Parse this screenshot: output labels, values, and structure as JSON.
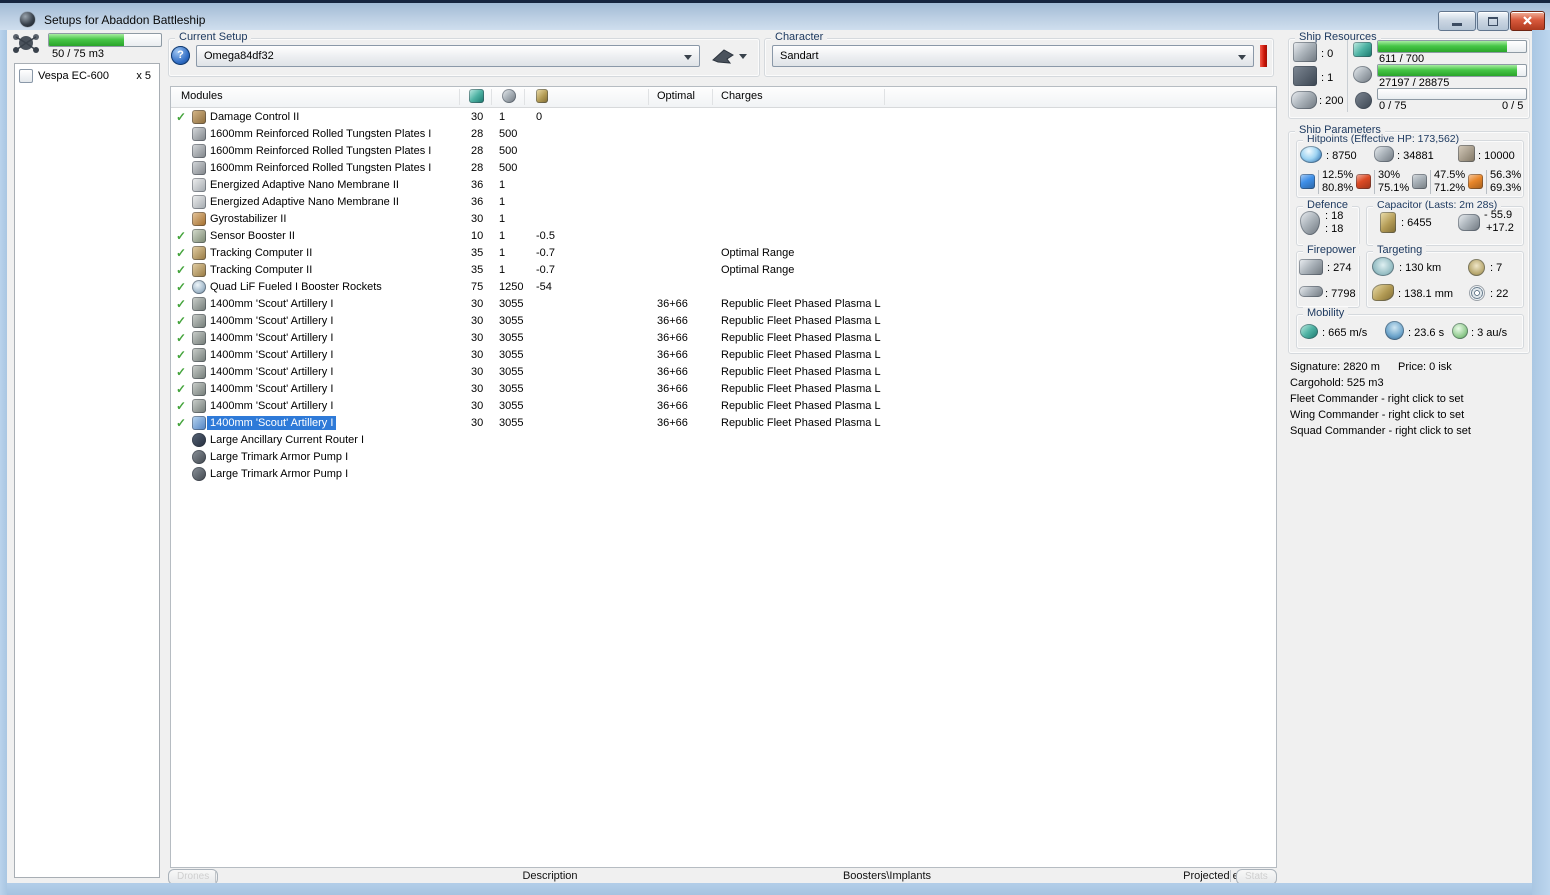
{
  "glyphs": {
    "check": "✓",
    "help": "?"
  },
  "window": {
    "title": "Setups for Abaddon Battleship"
  },
  "drone_bay": {
    "usage": "50 / 75 m3",
    "fill_pct": 67,
    "items": [
      {
        "name": "Vespa EC-600",
        "count": "x 5"
      }
    ]
  },
  "current_setup": {
    "label": "Current Setup",
    "value": "Omega84df32"
  },
  "character": {
    "label": "Character",
    "value": "Sandart"
  },
  "modules": {
    "columns": {
      "name": "Modules",
      "optimal": "Optimal",
      "charges": "Charges"
    },
    "rows": [
      {
        "name": "Damage Control II",
        "cpu": "30",
        "pg": "1",
        "cap": "0",
        "optimal": "",
        "charges": "",
        "checked": true,
        "icon": "i-dc"
      },
      {
        "name": "1600mm Reinforced Rolled Tungsten Plates I",
        "cpu": "28",
        "pg": "500",
        "cap": "",
        "optimal": "",
        "charges": "",
        "icon": "i-plate"
      },
      {
        "name": "1600mm Reinforced Rolled Tungsten Plates I",
        "cpu": "28",
        "pg": "500",
        "cap": "",
        "optimal": "",
        "charges": "",
        "icon": "i-plate"
      },
      {
        "name": "1600mm Reinforced Rolled Tungsten Plates I",
        "cpu": "28",
        "pg": "500",
        "cap": "",
        "optimal": "",
        "charges": "",
        "icon": "i-plate"
      },
      {
        "name": "Energized Adaptive Nano Membrane II",
        "cpu": "36",
        "pg": "1",
        "cap": "",
        "optimal": "",
        "charges": "",
        "icon": "i-eanm"
      },
      {
        "name": "Energized Adaptive Nano Membrane II",
        "cpu": "36",
        "pg": "1",
        "cap": "",
        "optimal": "",
        "charges": "",
        "icon": "i-eanm"
      },
      {
        "name": "Gyrostabilizer II",
        "cpu": "30",
        "pg": "1",
        "cap": "",
        "optimal": "",
        "charges": "",
        "icon": "i-gyro"
      },
      {
        "name": "Sensor Booster II",
        "cpu": "10",
        "pg": "1",
        "cap": "-0.5",
        "optimal": "",
        "charges": "",
        "checked": true,
        "icon": "i-senso"
      },
      {
        "name": "Tracking Computer II",
        "cpu": "35",
        "pg": "1",
        "cap": "-0.7",
        "optimal": "",
        "charges": "Optimal Range",
        "checked": true,
        "icon": "i-tc"
      },
      {
        "name": "Tracking Computer II",
        "cpu": "35",
        "pg": "1",
        "cap": "-0.7",
        "optimal": "",
        "charges": "Optimal Range",
        "checked": true,
        "icon": "i-tc"
      },
      {
        "name": "Quad LiF Fueled I Booster Rockets",
        "cpu": "75",
        "pg": "1250",
        "cap": "-54",
        "optimal": "",
        "charges": "",
        "checked": true,
        "icon": "i-mwd"
      },
      {
        "name": "1400mm 'Scout' Artillery I",
        "cpu": "30",
        "pg": "3055",
        "cap": "",
        "optimal": "36+66",
        "charges": "Republic Fleet Phased Plasma L",
        "checked": true,
        "icon": "i-arty"
      },
      {
        "name": "1400mm 'Scout' Artillery I",
        "cpu": "30",
        "pg": "3055",
        "cap": "",
        "optimal": "36+66",
        "charges": "Republic Fleet Phased Plasma L",
        "checked": true,
        "icon": "i-arty"
      },
      {
        "name": "1400mm 'Scout' Artillery I",
        "cpu": "30",
        "pg": "3055",
        "cap": "",
        "optimal": "36+66",
        "charges": "Republic Fleet Phased Plasma L",
        "checked": true,
        "icon": "i-arty"
      },
      {
        "name": "1400mm 'Scout' Artillery I",
        "cpu": "30",
        "pg": "3055",
        "cap": "",
        "optimal": "36+66",
        "charges": "Republic Fleet Phased Plasma L",
        "checked": true,
        "icon": "i-arty"
      },
      {
        "name": "1400mm 'Scout' Artillery I",
        "cpu": "30",
        "pg": "3055",
        "cap": "",
        "optimal": "36+66",
        "charges": "Republic Fleet Phased Plasma L",
        "checked": true,
        "icon": "i-arty"
      },
      {
        "name": "1400mm 'Scout' Artillery I",
        "cpu": "30",
        "pg": "3055",
        "cap": "",
        "optimal": "36+66",
        "charges": "Republic Fleet Phased Plasma L",
        "checked": true,
        "icon": "i-arty"
      },
      {
        "name": "1400mm 'Scout' Artillery I",
        "cpu": "30",
        "pg": "3055",
        "cap": "",
        "optimal": "36+66",
        "charges": "Republic Fleet Phased Plasma L",
        "checked": true,
        "icon": "i-arty"
      },
      {
        "name": "1400mm 'Scout' Artillery I",
        "cpu": "30",
        "pg": "3055",
        "cap": "",
        "optimal": "36+66",
        "charges": "Republic Fleet Phased Plasma L",
        "checked": true,
        "selected": true,
        "icon": "i-arty-sel"
      },
      {
        "name": "Large Ancillary Current Router I",
        "cpu": "",
        "pg": "",
        "cap": "",
        "optimal": "",
        "charges": "",
        "icon": "i-rig-router"
      },
      {
        "name": "Large Trimark Armor Pump I",
        "cpu": "",
        "pg": "",
        "cap": "",
        "optimal": "",
        "charges": "",
        "icon": "i-rig-pump"
      },
      {
        "name": "Large Trimark Armor Pump I",
        "cpu": "",
        "pg": "",
        "cap": "",
        "optimal": "",
        "charges": "",
        "icon": "i-rig-pump"
      }
    ]
  },
  "ship_resources": {
    "title": "Ship Resources",
    "turrets": ": 0",
    "launchers": ": 1",
    "calibration": ": 200",
    "cpu": {
      "text": "611 / 700",
      "pct": 87
    },
    "powergrid": {
      "text": "27197 / 28875",
      "pct": 94
    },
    "drone_bandwidth": {
      "text": "0 / 75",
      "pct": 0
    },
    "drones_active": "0 / 5"
  },
  "ship_parameters": {
    "title": "Ship Parameters",
    "hitpoints": {
      "title": "Hitpoints (Effective HP: 173,562)",
      "shield": ": 8750",
      "armor": ": 34881",
      "hull": ": 10000",
      "resists": [
        {
          "name": "em",
          "color": "#3e8fe8",
          "shield": "12.5%",
          "armor": "80.8%"
        },
        {
          "name": "thermal",
          "color": "#dc4a24",
          "shield": "30%",
          "armor": "75.1%"
        },
        {
          "name": "kinetic",
          "color": "#a7b0b7",
          "shield": "47.5%",
          "armor": "71.2%"
        },
        {
          "name": "explosive",
          "color": "#e8862a",
          "shield": "56.3%",
          "armor": "69.3%"
        }
      ]
    },
    "defence": {
      "title": "Defence",
      "v1": ": 18",
      "v2": ": 18"
    },
    "capacitor": {
      "title": "Capacitor (Lasts: 2m 28s)",
      "amount": ": 6455",
      "peak_neg": "- 55.9",
      "peak_pos": "+17.2"
    },
    "firepower": {
      "title": "Firepower",
      "dps": ": 274",
      "volley": ": 7798"
    },
    "targeting": {
      "title": "Targeting",
      "range": ": 130 km",
      "scan_res": ": 138.1 mm",
      "max_targets": ": 7",
      "sensor_strength": ": 22"
    },
    "mobility": {
      "title": "Mobility",
      "speed": ": 665 m/s",
      "align": ": 23.6 s",
      "warp": ": 3 au/s"
    },
    "info": {
      "signature": "Signature: 2820 m",
      "price": "Price: 0 isk",
      "cargohold": "Cargohold: 525 m3",
      "fleet": "Fleet Commander - right click to set",
      "wing": "Wing Commander - right click to set",
      "squad": "Squad Commander - right click to set"
    }
  },
  "footer": {
    "drones_button": "Drones",
    "tab_description": "Description",
    "tab_boosters": "Boosters\\Implants",
    "tab_projected": "Projected effects",
    "stats_button": "Stats"
  }
}
